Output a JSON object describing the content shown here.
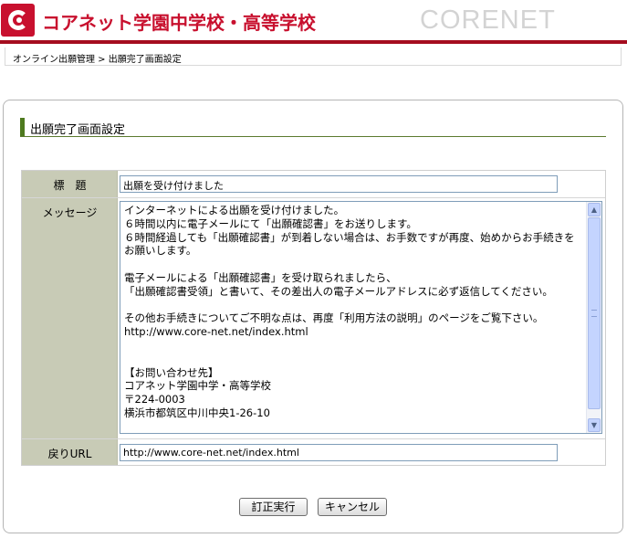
{
  "header": {
    "school_name": "コアネット学園中学校・高等学校",
    "brand": "CORENET",
    "logo_icon": "corenet-c-logo-icon"
  },
  "breadcrumb": "オンライン出願管理 > 出願完了画面設定",
  "section_title": "出願完了画面設定",
  "form": {
    "title_label": "標　題",
    "title_value": "出願を受け付けました",
    "message_label": "メッセージ",
    "message_value": "インターネットによる出願を受け付けました。\n６時間以内に電子メールにて「出願確認書」をお送りします。\n６時間経過しても「出願確認書」が到着しない場合は、お手数ですが再度、始めからお手続きをお願いします。\n\n電子メールによる「出願確認書」を受け取られましたら、\n「出願確認書受領」と書いて、その差出人の電子メールアドレスに必ず返信してください。\n\nその他お手続きについてご不明な点は、再度「利用方法の説明」のページをご覧下さい。\nhttp://www.core-net.net/index.html\n\n\n【お問い合わせ先】\nコアネット学園中学・高等学校\n〒224-0003\n横浜市都筑区中川中央1-26-10",
    "return_url_label": "戻りURL",
    "return_url_value": "http://www.core-net.net/index.html"
  },
  "buttons": {
    "submit": "訂正実行",
    "cancel": "キャンセル"
  },
  "colors": {
    "brand_red": "#c8102e",
    "header_bar": "#a50d1f",
    "label_bg": "#c8cbb6",
    "section_marker": "#4e7a1e"
  }
}
